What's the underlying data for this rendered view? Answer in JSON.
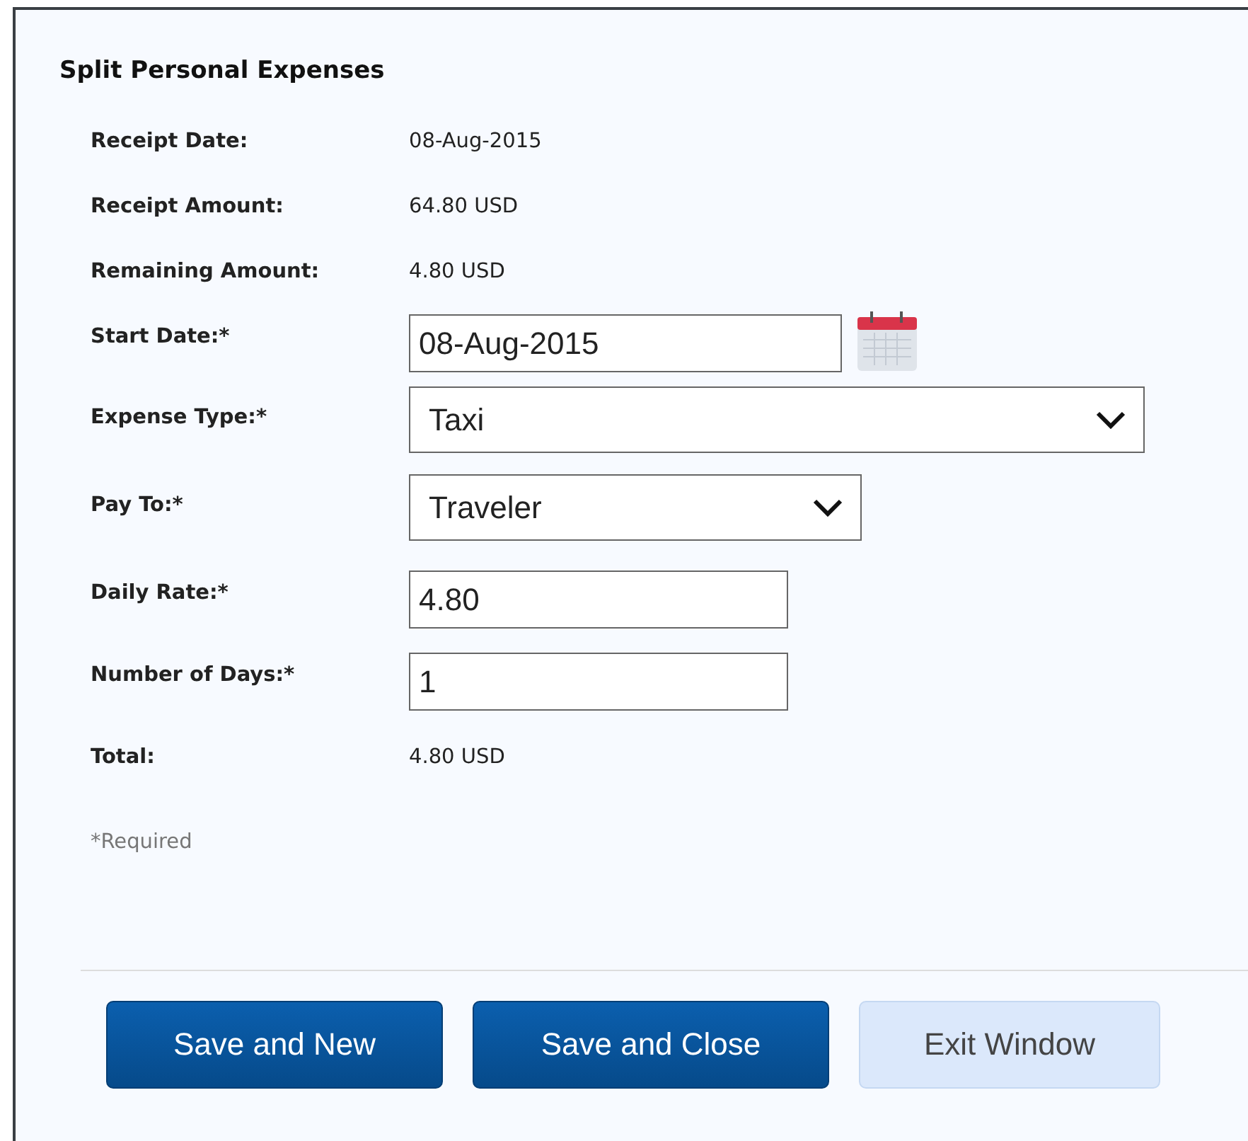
{
  "dialog": {
    "title": "Split Personal Expenses"
  },
  "rows": [
    {
      "kind": "text",
      "label": "Receipt Date:",
      "value": "08-Aug-2015"
    },
    {
      "kind": "text",
      "label": "Receipt Amount:",
      "value": "64.80 USD"
    },
    {
      "kind": "text",
      "label": "Remaining Amount:",
      "value": "4.80 USD"
    },
    {
      "kind": "date",
      "label": "Start Date:*",
      "value": "08-Aug-2015"
    },
    {
      "kind": "select",
      "label": "Expense Type:*",
      "value": "Taxi"
    },
    {
      "kind": "select",
      "label": "Pay To:*",
      "value": "Traveler"
    },
    {
      "kind": "input",
      "label": "Daily Rate:*",
      "value": "4.80"
    },
    {
      "kind": "input",
      "label": "Number of Days:*",
      "value": "1"
    },
    {
      "kind": "text",
      "label": "Total:",
      "value": "4.80 USD"
    }
  ],
  "note": "*Required",
  "buttons": [
    {
      "label": "Save and New",
      "kind": "primary"
    },
    {
      "label": "Save and Close",
      "kind": "primary"
    },
    {
      "label": "Exit Window",
      "kind": "secondary"
    }
  ]
}
